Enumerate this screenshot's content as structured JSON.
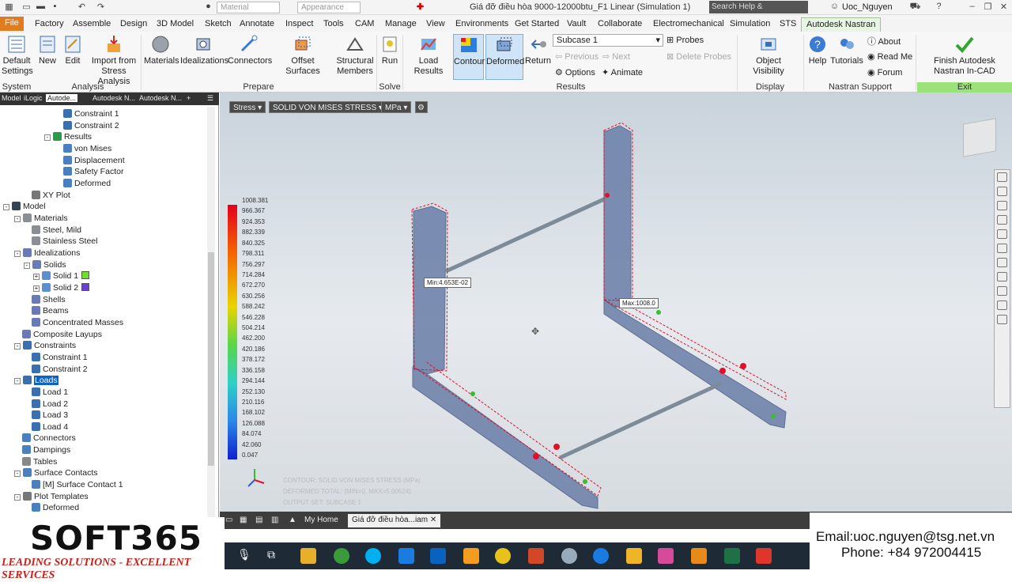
{
  "titlebar": {
    "material_combo": "Material",
    "appearance_combo": "Appearance",
    "doc_title": "Giá đỡ điều hòa 9000-12000btu_F1 Linear (Simulation 1)",
    "search": "Search Help & Commands...",
    "user": "Uoc_Nguyen"
  },
  "tabs": [
    "File",
    "Factory",
    "Assemble",
    "Design",
    "3D Model",
    "Sketch",
    "Annotate",
    "Inspect",
    "Tools",
    "CAM",
    "Manage",
    "View",
    "Environments",
    "Get Started",
    "Vault",
    "Collaborate",
    "Electromechanical",
    "Simulation",
    "STS",
    "Autodesk Nastran"
  ],
  "ribbon": {
    "default_settings": "Default Settings",
    "new": "New",
    "edit": "Edit",
    "import_stress": "Import from Stress Analysis",
    "materials": "Materials",
    "idealizations": "Idealizations",
    "connectors": "Connectors",
    "offset_surfaces": "Offset Surfaces",
    "structural_members": "Structural Members",
    "run": "Run",
    "load_results": "Load Results",
    "contour": "Contour",
    "deformed": "Deformed",
    "return": "Return",
    "subcase": "Subcase 1",
    "probes": "Probes",
    "previous": "Previous",
    "next": "Next",
    "delete_probes": "Delete Probes",
    "options": "Options",
    "animate": "Animate",
    "object_visibility": "Object Visibility",
    "help": "Help",
    "tutorials": "Tutorials",
    "about": "About",
    "read_me": "Read Me",
    "forum": "Forum",
    "finish": "Finish Autodesk Nastran In-CAD",
    "groups": {
      "system": "System",
      "analysis": "Analysis",
      "prepare": "Prepare",
      "solve": "Solve",
      "results": "Results",
      "display": "Display",
      "nastran_support": "Nastran Support",
      "exit": "Exit"
    }
  },
  "browser": {
    "tabs": [
      "Model",
      "iLogic",
      "Autode...",
      "Autodesk N...",
      "Autodesk N..."
    ],
    "tree": [
      {
        "label": "Constraint 1",
        "indent": 80,
        "icon": "constraint"
      },
      {
        "label": "Constraint 2",
        "indent": 80,
        "icon": "constraint"
      },
      {
        "label": "Results",
        "indent": 56,
        "icon": "results",
        "exp": "-"
      },
      {
        "label": "von Mises",
        "indent": 80,
        "icon": "result"
      },
      {
        "label": "Displacement",
        "indent": 80,
        "icon": "result"
      },
      {
        "label": "Safety Factor",
        "indent": 80,
        "icon": "result"
      },
      {
        "label": "Deformed",
        "indent": 80,
        "icon": "result"
      },
      {
        "label": "XY Plot",
        "indent": 40,
        "icon": "plot"
      },
      {
        "label": "Model",
        "indent": 4,
        "icon": "model",
        "exp": "-"
      },
      {
        "label": "Materials",
        "indent": 18,
        "icon": "material",
        "exp": "-"
      },
      {
        "label": "Steel, Mild",
        "indent": 40,
        "icon": "material"
      },
      {
        "label": "Stainless Steel",
        "indent": 40,
        "icon": "material"
      },
      {
        "label": "Idealizations",
        "indent": 18,
        "icon": "ideal",
        "exp": "-"
      },
      {
        "label": "Solids",
        "indent": 30,
        "icon": "ideal",
        "exp": "-"
      },
      {
        "label": "Solid 1",
        "indent": 42,
        "icon": "solid",
        "exp": "+",
        "swatch": "#6ee02a"
      },
      {
        "label": "Solid 2",
        "indent": 42,
        "icon": "solid",
        "exp": "+",
        "swatch": "#6b3fd6"
      },
      {
        "label": "Shells",
        "indent": 40,
        "icon": "ideal"
      },
      {
        "label": "Beams",
        "indent": 40,
        "icon": "ideal"
      },
      {
        "label": "Concentrated Masses",
        "indent": 40,
        "icon": "ideal"
      },
      {
        "label": "Composite Layups",
        "indent": 28,
        "icon": "ideal"
      },
      {
        "label": "Constraints",
        "indent": 18,
        "icon": "constraint",
        "exp": "-"
      },
      {
        "label": "Constraint 1",
        "indent": 40,
        "icon": "constraint"
      },
      {
        "label": "Constraint 2",
        "indent": 40,
        "icon": "constraint"
      },
      {
        "label": "Loads",
        "indent": 18,
        "icon": "load",
        "exp": "-",
        "selected": true
      },
      {
        "label": "Load 1",
        "indent": 40,
        "icon": "load"
      },
      {
        "label": "Load 2",
        "indent": 40,
        "icon": "load"
      },
      {
        "label": "Load 3",
        "indent": 40,
        "icon": "load"
      },
      {
        "label": "Load 4",
        "indent": 40,
        "icon": "load"
      },
      {
        "label": "Connectors",
        "indent": 28,
        "icon": "connector"
      },
      {
        "label": "Dampings",
        "indent": 28,
        "icon": "connector"
      },
      {
        "label": "Tables",
        "indent": 28,
        "icon": "table"
      },
      {
        "label": "Surface Contacts",
        "indent": 18,
        "icon": "contact",
        "exp": "-"
      },
      {
        "label": "[M] Surface Contact 1",
        "indent": 40,
        "icon": "contact"
      },
      {
        "label": "Plot Templates",
        "indent": 18,
        "icon": "plot",
        "exp": "-"
      },
      {
        "label": "Deformed",
        "indent": 40,
        "icon": "result"
      }
    ]
  },
  "canvas": {
    "result_type": "Stress",
    "component": "SOLID VON MISES STRESS",
    "unit": "MPa",
    "legend_values": [
      "1008.381",
      "966.367",
      "924.353",
      "882.339",
      "840.325",
      "798.311",
      "756.297",
      "714.284",
      "672.270",
      "630.256",
      "588.242",
      "546.228",
      "504.214",
      "462.200",
      "420.186",
      "378.172",
      "336.158",
      "294.144",
      "252.130",
      "210.116",
      "168.102",
      "126.088",
      "84.074",
      "42.060",
      "0.047"
    ],
    "min_label": "Min:4.653E-02",
    "max_label": "Max:1008.0",
    "info_lines": [
      "CONTOUR: SOLID VON MISES STRESS (MPa)",
      "DEFORMED TOTAL: (MIN=0, MAX=5.00524)",
      "OUTPUT SET: SUBCASE 1"
    ],
    "colors": {
      "mesh": "#5a6f9a",
      "red": "#e0102a"
    }
  },
  "doctabs": {
    "home": "My Home",
    "doc": "Giá đỡ điều hòa...iam"
  },
  "logo": {
    "brand": "SOFT365",
    "tagline": "LEADING SOLUTIONS - EXCELLENT SERVICES"
  },
  "contact": {
    "email": "Email:uoc.nguyen@tsg.net.vn",
    "phone": "Phone: +84 972004415"
  }
}
